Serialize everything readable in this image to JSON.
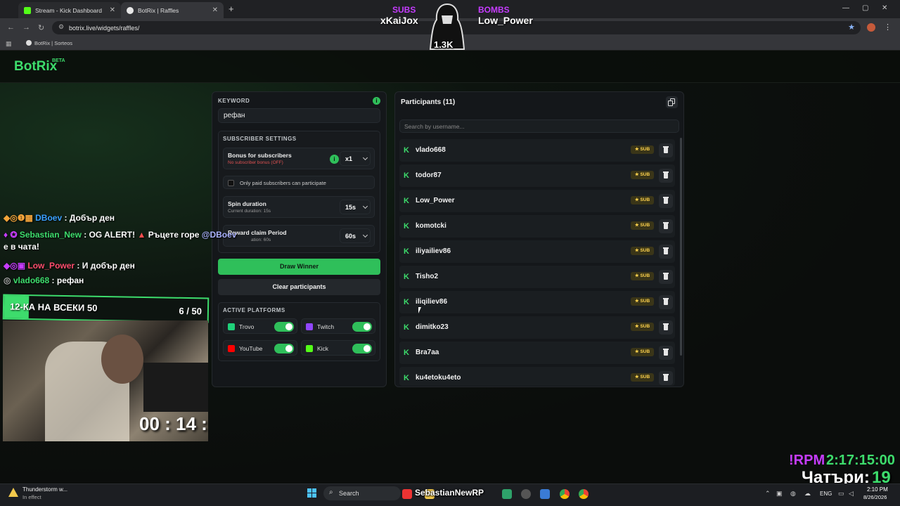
{
  "browser": {
    "tabs": [
      {
        "title": "Stream - Kick Dashboard",
        "active": false
      },
      {
        "title": "BotRix | Raffles",
        "active": true
      }
    ],
    "url": "botrix.live/widgets/raffles/",
    "bookmark": "BotRix | Sorteos"
  },
  "app": {
    "logo": "BotRix",
    "beta": "BETA"
  },
  "keyword": {
    "label": "KEYWORD",
    "value": "рефан"
  },
  "subscriber_settings": {
    "title": "SUBSCRIBER SETTINGS",
    "bonus_title": "Bonus for subscribers",
    "bonus_sub": "No subscriber bonus (OFF)",
    "bonus_value": "x1",
    "only_paid": "Only paid subscribers can participate",
    "spin_title": "Spin duration",
    "spin_sub": "Current duration: 15s",
    "spin_value": "15s",
    "claim_title": "Reward claim Period",
    "claim_sub": "ation: 60s",
    "claim_value": "60s"
  },
  "buttons": {
    "draw": "Draw Winner",
    "clear": "Clear participants"
  },
  "platforms": {
    "title": "ACTIVE PLATFORMS",
    "items": [
      {
        "name": "Trovo",
        "color": "#1fd17a"
      },
      {
        "name": "Twitch",
        "color": "#9146ff"
      },
      {
        "name": "YouTube",
        "color": "#ff0000"
      },
      {
        "name": "Kick",
        "color": "#53fc18"
      }
    ]
  },
  "participants": {
    "title": "Participants (11)",
    "search_placeholder": "Search by username...",
    "badge": "SUB",
    "list": [
      "vlado668",
      "todor87",
      "Low_Power",
      "komotcki",
      "iliyailiev86",
      "Tisho2",
      "iliqiliev86",
      "dimitko23",
      "Bra7aa",
      "ku4etoku4eto"
    ]
  },
  "overlay": {
    "subs_label": "SUBS",
    "subs_name": "xKaiJox",
    "bombs_label": "BOMBS",
    "bombs_name": "Low_Power",
    "count": "1.3K",
    "chat": [
      {
        "user": "DBoev",
        "sep": " : ",
        "msg": "Добър ден",
        "color": "#3aa0ff"
      },
      {
        "user": "Sebastian_New",
        "sep": " : ",
        "msg": "OG ALERT!",
        "msg2": "Ръцете горе",
        "mention": "@DBoev",
        "color": "#3ddc6c"
      },
      {
        "cont": "е в чата!"
      },
      {
        "user": "Low_Power",
        "sep": " : ",
        "msg": "И добър ден",
        "color": "#ff4d6d"
      },
      {
        "user": "vlado668",
        "sep": " : ",
        "msg": "рефан",
        "color": "#3ddc6c"
      }
    ],
    "goal_title": "12-КА НА ВСЕКИ 50",
    "goal_value": "6 / 50",
    "goal_progress": 0.12,
    "timer": "00 : 14 :",
    "rpm_label": "!RPM",
    "rpm_time": "2:17:15:00",
    "day_label": "Чатъри:",
    "day_value": "19"
  },
  "taskbar": {
    "weather_title": "Thunderstorm w...",
    "weather_sub": "In effect",
    "search": "Search",
    "overlay_name": "SebastianNewRP",
    "lang": "ENG",
    "time": "2:10 PM",
    "date": "8/26/2026"
  }
}
